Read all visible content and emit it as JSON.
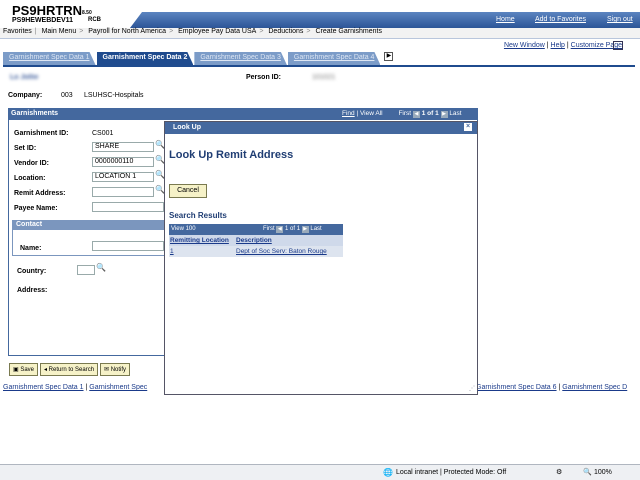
{
  "header": {
    "title": "PS9HRTRN",
    "version": "8.50",
    "subtitle": "PS9HEWEBDEV11",
    "user_code": "RCB",
    "links": [
      "Home",
      "Add to Favorites",
      "Sign out"
    ]
  },
  "menu": {
    "items": [
      "Favorites",
      "Main Menu",
      "Payroll for North America",
      "Employee Pay Data USA",
      "Deductions",
      "Create Garnishments"
    ]
  },
  "top_links": [
    "New Window",
    "Help",
    "Customize Page"
  ],
  "tabs": [
    "Garnishment Spec Data 1",
    "Garnishment Spec Data 2",
    "Garnishment Spec Data 3",
    "Garnishment Spec Data 4"
  ],
  "employee": {
    "name": "Lo Jollie",
    "person_id_label": "Person ID:",
    "person_id": "101021"
  },
  "company": {
    "label": "Company:",
    "code": "003",
    "name": "LSUHSC-Hospitals"
  },
  "garnishments": {
    "title": "Garnishments",
    "find": "Find",
    "view_all": "View All",
    "first": "First",
    "page": "1 of 1",
    "last": "Last",
    "fields": {
      "garnishment_id_label": "Garnishment ID:",
      "garnishment_id": "CS001",
      "setid_label": "Set ID:",
      "setid": "SHARE",
      "vendor_id_label": "Vendor ID:",
      "vendor_id": "0000000110",
      "location_label": "Location:",
      "location": "LOCATION 1",
      "remit_label": "Remit Address:",
      "remit": "",
      "payee_label": "Payee Name:",
      "payee": ""
    },
    "contact_title": "Contact",
    "name_label": "Name:",
    "country_label": "Country:",
    "address_label": "Address:"
  },
  "buttons": {
    "save": "Save",
    "return": "Return to Search",
    "notify": "Notify"
  },
  "bottom_links": [
    "Garnishment Spec Data 1",
    "Garnishment Spec",
    "Garnishment Spec Data 6",
    "Garnishment Spec D"
  ],
  "modal": {
    "title": "Look Up",
    "close": "×",
    "heading": "Look Up Remit Address",
    "cancel": "Cancel",
    "results_title": "Search Results",
    "view": "View 100",
    "first": "First",
    "page": "1 of 1",
    "last": "Last",
    "col1": "Remitting Location",
    "col2": "Description",
    "rows": [
      {
        "loc": "1",
        "desc": "Dept of Soc Serv: Baton Rouge"
      }
    ]
  },
  "status_bar": {
    "zone": "Local intranet | Protected Mode: Off",
    "zoom": "100%"
  }
}
